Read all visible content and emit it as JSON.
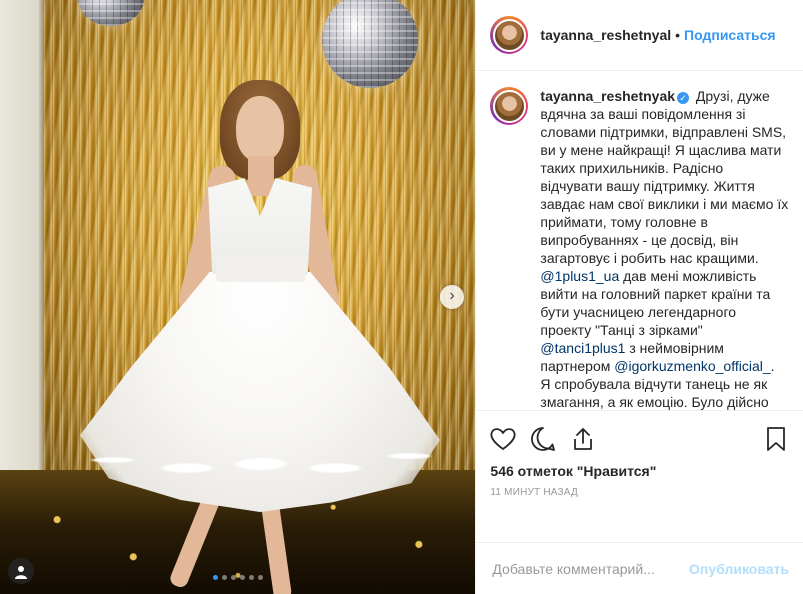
{
  "post": {
    "author": "tayanna_reshetnyal",
    "follow_label": "Подписаться",
    "separator": "•",
    "caption_author": "tayanna_reshetnyak",
    "verified_mark": "✓",
    "caption_parts": {
      "p1": " Друзі, дуже вдячна за ваші повідомлення зі словами підтримки, відправлені SMS, ви у мене найкращі! Я щаслива мати таких прихильників. Радісно відчувати вашу підтримку. Життя завдає нам свої виклики і ми маємо їх приймати, тому головне в випробуваннях - це досвід, він загартовує і робить нас кращими. ",
      "m1": "@1plus1_ua",
      "p2": " дав мені можливість вийти на головний паркет країни та бути учасницею легендарного проекту \"Танці з зірками\" ",
      "m2": "@tanci1plus1",
      "p3": " з неймовірним партнером ",
      "m3": "@igorkuzmenko_official_",
      "p4": ". Я спробувала відчути танець не як змагання, а як емоцію. Було дійсно незабутньо, два тижні як ціле маленьке життя. Щиро дякую всім! І"
    },
    "likes": "546 отметок \"Нравится\"",
    "time": "11 минут назад"
  },
  "comment_form": {
    "placeholder": "Добавьте комментарий...",
    "publish_label": "Опубликовать"
  },
  "carousel": {
    "slides": 6,
    "active_index": 0
  },
  "icons": {
    "like": "heart-icon",
    "comment": "comment-icon",
    "share": "share-icon",
    "save": "bookmark-icon",
    "next": "chevron-right-icon",
    "tagged": "user-tag-icon"
  },
  "colors": {
    "link_blue": "#3897f0",
    "mention_blue": "#003569",
    "muted": "#999999",
    "border": "#efefef"
  }
}
